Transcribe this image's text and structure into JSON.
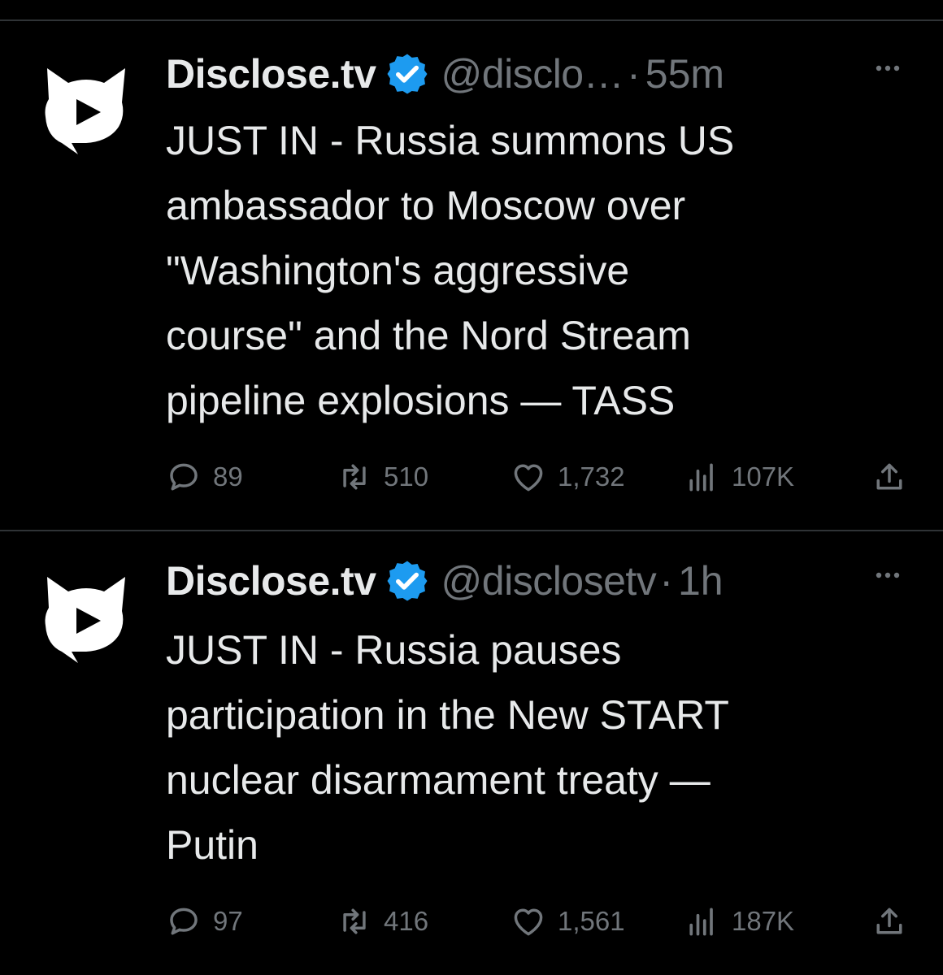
{
  "tweets": [
    {
      "display_name": "Disclose.tv",
      "handle": "@disclo…",
      "separator": "·",
      "time": "55m",
      "text": "JUST IN - Russia summons US\nambassador to Moscow over\n\"Washington's aggressive\ncourse\" and the Nord Stream\npipeline explosions — TASS",
      "replies": "89",
      "reposts": "510",
      "likes": "1,732",
      "views": "107K"
    },
    {
      "display_name": "Disclose.tv",
      "handle": "@disclosetv",
      "separator": "·",
      "time": "1h",
      "text": "JUST IN - Russia pauses\nparticipation in the New START\nnuclear disarmament treaty —\nPutin",
      "replies": "97",
      "reposts": "416",
      "likes": "1,561",
      "views": "187K"
    }
  ],
  "icons": {
    "avatar": "disclose-tv-logo-icon",
    "verified": "verified-badge-icon",
    "more": "more-options-icon",
    "reply": "reply-icon",
    "repost": "repost-icon",
    "like": "like-icon",
    "views": "views-icon",
    "share": "share-icon"
  },
  "colors": {
    "background": "#000000",
    "text": "#e7e9ea",
    "secondary": "#71767b",
    "verified": "#1d9bf0",
    "divider": "#2f3336"
  }
}
